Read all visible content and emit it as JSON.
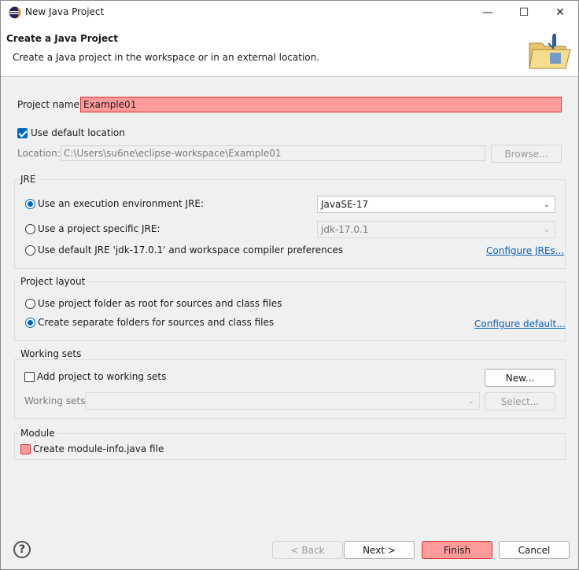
{
  "window": {
    "title": "New Java Project",
    "minimize_glyph": "—",
    "maximize_glyph": "☐",
    "close_glyph": "✕"
  },
  "header": {
    "title": "Create a Java Project",
    "description": "Create a Java project in the workspace or in an external location."
  },
  "project_name": {
    "label": "Project name:",
    "value": "Example01"
  },
  "use_default_location": {
    "label": "Use default location",
    "checked": true
  },
  "location": {
    "label": "Location:",
    "value": "C:\\Users\\su6ne\\eclipse-workspace\\Example01",
    "browse_label": "Browse..."
  },
  "jre": {
    "title": "JRE",
    "opt_exec_env": "Use an execution environment JRE:",
    "exec_env_value": "JavaSE-17",
    "opt_project_specific": "Use a project specific JRE:",
    "project_specific_value": "jdk-17.0.1",
    "opt_default": "Use default JRE 'jdk-17.0.1' and workspace compiler preferences",
    "configure_link": "Configure JREs...",
    "selected": "exec_env"
  },
  "project_layout": {
    "title": "Project layout",
    "opt_root": "Use project folder as root for sources and class files",
    "opt_separate": "Create separate folders for sources and class files",
    "configure_link": "Configure default...",
    "selected": "separate"
  },
  "working_sets": {
    "title": "Working sets",
    "add_label": "Add project to working sets",
    "add_checked": false,
    "new_label": "New...",
    "sets_label": "Working sets:",
    "select_label": "Select..."
  },
  "module": {
    "title": "Module",
    "create_label": "Create module-info.java file",
    "checked": false
  },
  "footer": {
    "help_glyph": "?",
    "back_label": "< Back",
    "next_label": "Next >",
    "finish_label": "Finish",
    "cancel_label": "Cancel"
  },
  "colors": {
    "highlight_fill": "#ff9b9b",
    "highlight_border": "#e0322f",
    "accent": "#0067c0",
    "link": "#0b5fbd",
    "dialog_bg": "#f0f0f0"
  },
  "icons": {
    "app": "eclipse-icon",
    "header": "java-project-folder-icon",
    "help": "help-icon"
  }
}
